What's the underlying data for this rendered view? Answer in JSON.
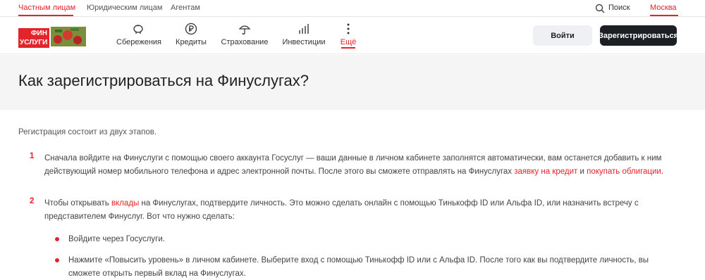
{
  "topbar": {
    "segments": [
      "Частным лицам",
      "Юридическим лицам",
      "Агентам"
    ],
    "search_label": "Поиск",
    "city": "Москва"
  },
  "logo": {
    "line1": "ФИН",
    "line2": "УСЛУГИ"
  },
  "nav": {
    "items": [
      {
        "label": "Сбережения",
        "icon": "piggy-bank-icon"
      },
      {
        "label": "Кредиты",
        "icon": "ruble-coin-icon"
      },
      {
        "label": "Страхование",
        "icon": "umbrella-icon"
      },
      {
        "label": "Инвестиции",
        "icon": "chart-icon"
      },
      {
        "label": "Ещё",
        "icon": "more-vertical-icon"
      }
    ],
    "login": "Войти",
    "register": "Зарегистрироваться"
  },
  "page": {
    "title": "Как зарегистрироваться на Финуслугах?",
    "intro": "Регистрация состоит из двух этапов.",
    "step1": {
      "num": "1",
      "text_a": "Сначала войдите на Финуслуги с помощью своего аккаунта Госуслуг — ваши данные в личном кабинете заполнятся автоматически, вам останется добавить к ним действующий номер мобильного телефона и адрес электронной почты. После этого вы сможете отправлять на Финуслугах ",
      "link1": "заявку на кредит",
      "text_b": " и ",
      "link2": "покупать облигации",
      "text_c": "."
    },
    "step2": {
      "num": "2",
      "text_a": "Чтобы открывать ",
      "link1": "вклады",
      "text_b": " на Финуслугах, подтвердите личность. Это можно сделать онлайн с помощью Тинькофф ID или Альфа ID, или назначить встречу с представителем Финуслуг. Вот что нужно сделать:"
    },
    "bullets": [
      "Войдите через Госуслуги.",
      "Нажмите «Повысить уровень» в личном кабинете. Выберите вход с помощью Тинькофф ID или с Альфа ID. После того как вы подтвердите личность, вы сможете открыть первый вклад на Финуслугах."
    ]
  },
  "colors": {
    "accent": "#e3242b",
    "dark_button": "#1c1f24",
    "hero_bg": "#f5f5f5"
  }
}
